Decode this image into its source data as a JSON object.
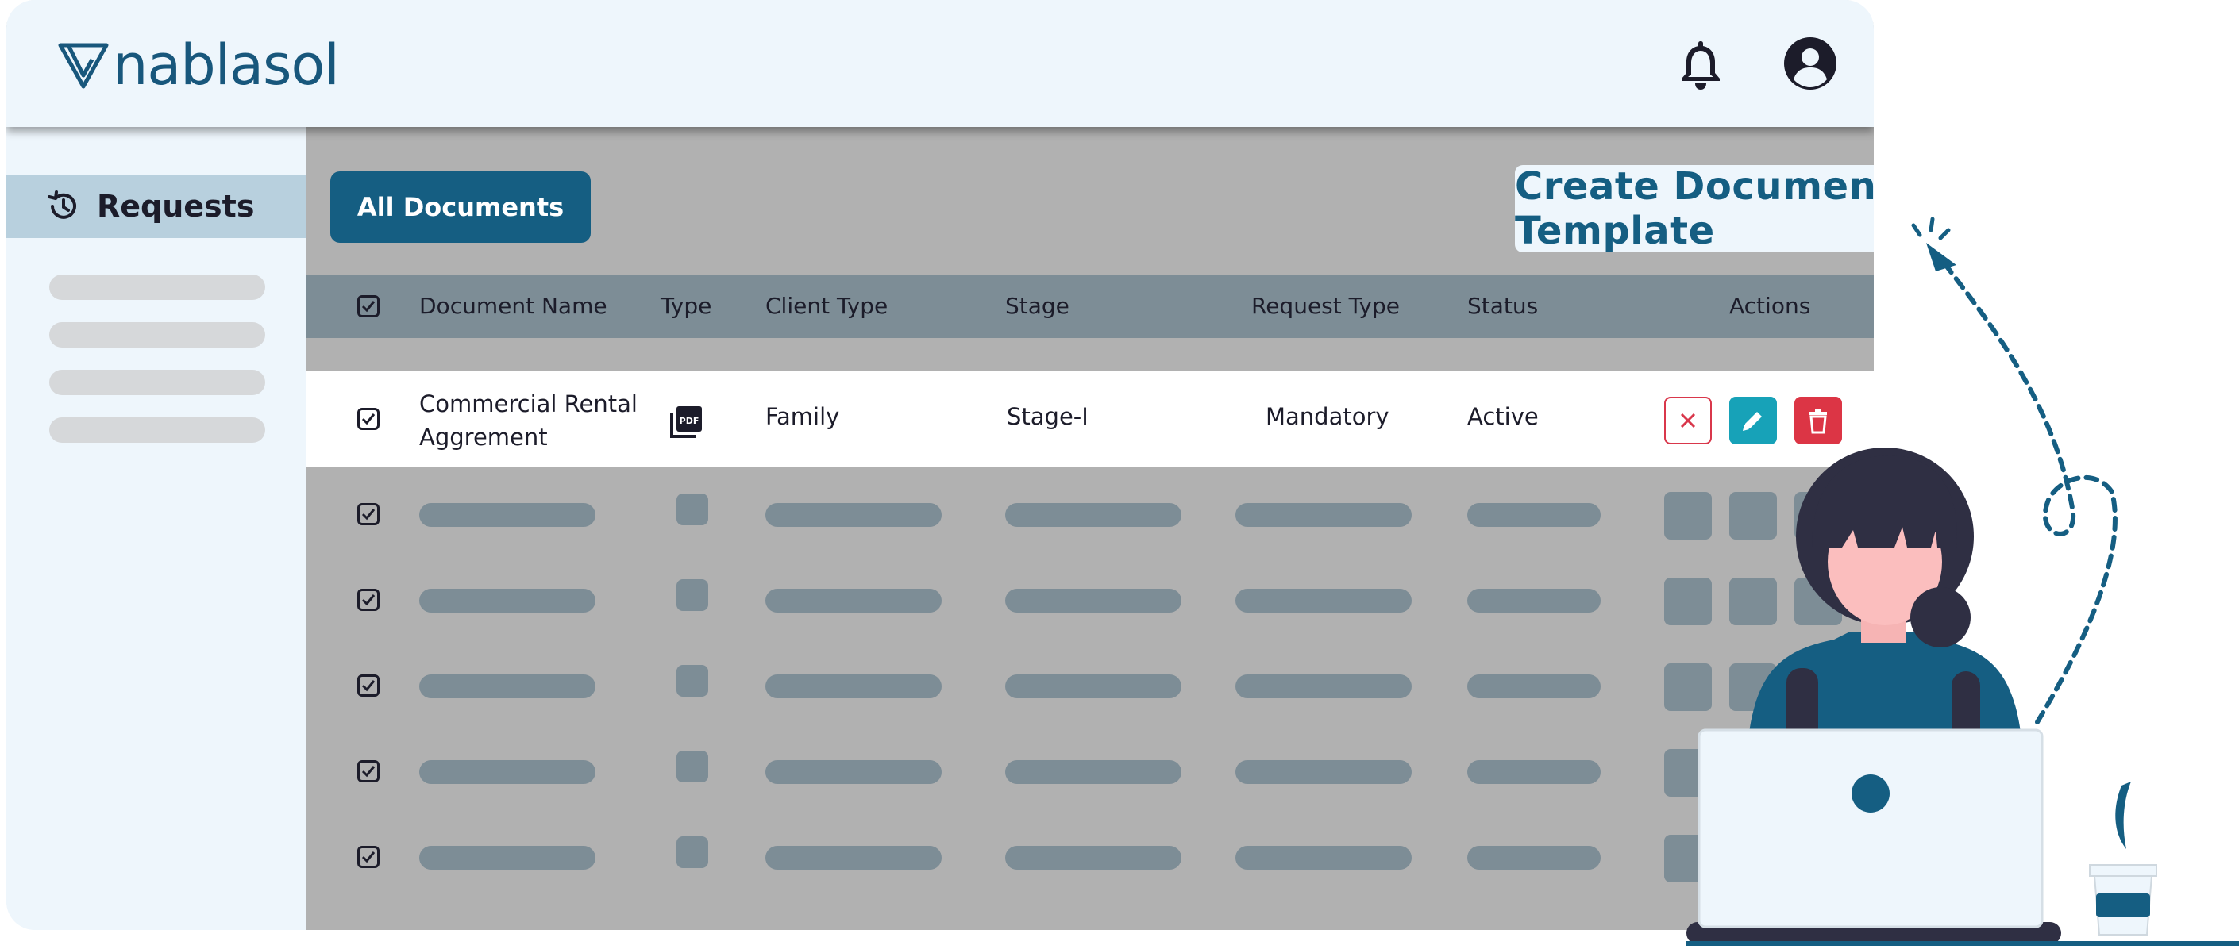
{
  "header": {
    "logo_text": "nablasol",
    "icons": [
      "bell-icon",
      "user-account-icon"
    ]
  },
  "sidebar": {
    "active_item": {
      "label": "Requests",
      "icon": "history-icon"
    },
    "placeholder_count": 4
  },
  "main": {
    "tab_label": "All Documents",
    "columns": [
      "Document Name",
      "Type",
      "Client Type",
      "Stage",
      "Request Type",
      "Status",
      "Actions"
    ],
    "row": {
      "document_name_line1": "Commercial Rental",
      "document_name_line2": "Aggrement",
      "type_icon": "pdf-icon",
      "client_type": "Family",
      "stage": "Stage-I",
      "request_type": "Mandatory",
      "status": "Active",
      "actions": [
        "close-icon",
        "edit-icon",
        "trash-icon"
      ]
    },
    "placeholder_rows": 5
  },
  "callout": {
    "text": "Create Document Request Template"
  },
  "colors": {
    "brand": "#155e82",
    "header_bg": "#eef6fc",
    "table_header": "#7d8d96",
    "close_outline": "#d9374b",
    "edit_button": "#17a2b8",
    "delete_button": "#dc3545"
  }
}
